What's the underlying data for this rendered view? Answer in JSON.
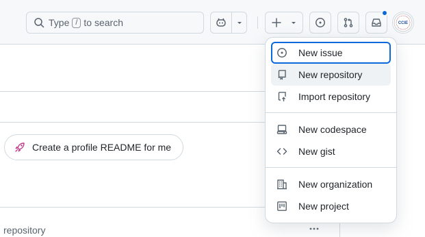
{
  "header": {
    "search": {
      "prefix": "Type",
      "key": "/",
      "suffix": "to search"
    },
    "icons": [
      "search-icon",
      "copilot-icon",
      "triangle-down-icon",
      "plus-icon",
      "issue-opened-icon",
      "git-pull-request-icon",
      "inbox-icon",
      "avatar"
    ],
    "notification_color": "#0969da"
  },
  "avatar": {
    "text": "CCIE"
  },
  "main": {
    "profile_readme_button": "Create a profile README for me",
    "repository_label": "repository"
  },
  "menu": {
    "items": [
      {
        "label": "New issue",
        "icon": "issue-opened-icon"
      },
      {
        "label": "New repository",
        "icon": "repo-icon"
      },
      {
        "label": "Import repository",
        "icon": "repo-push-icon"
      },
      {
        "label": "New codespace",
        "icon": "codespaces-icon"
      },
      {
        "label": "New gist",
        "icon": "code-icon"
      },
      {
        "label": "New organization",
        "icon": "organization-icon"
      },
      {
        "label": "New project",
        "icon": "project-icon"
      }
    ]
  },
  "colors": {
    "accent": "#0969da",
    "border": "#d1d9e0",
    "header_bg": "#f6f8fa",
    "text": "#1f2328",
    "muted": "#59636e"
  }
}
